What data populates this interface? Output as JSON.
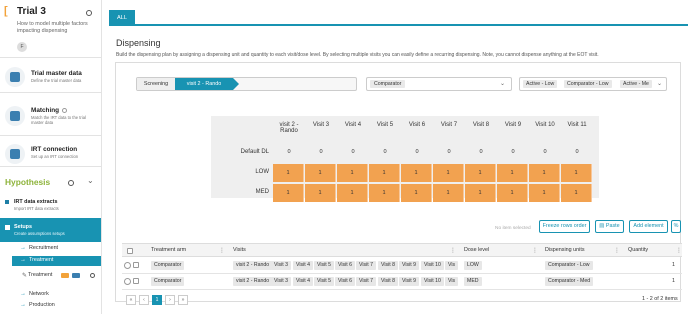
{
  "sidebar": {
    "trial_title": "Trial 3",
    "trial_desc": "How to model multiple factors impacting dispensing",
    "avatar_initial": "F",
    "cards": [
      {
        "title": "Trial master data",
        "subtitle": "Define the trial master data"
      },
      {
        "title": "Matching",
        "subtitle": "Match the IRT data to the trial master data"
      },
      {
        "title": "IRT connection",
        "subtitle": "Set up an IRT connection"
      }
    ],
    "hypothesis_title": "Hypothesis",
    "irt_title": "IRT data extracts",
    "irt_sub": "Import IRT data extracts",
    "setups_title": "Setups",
    "setups_sub": "Create assumptions setups",
    "tree": {
      "recruitment": "Recruitment",
      "treatment": "Treatment",
      "treatment_sub": "Treatment",
      "network": "Network",
      "production": "Production"
    }
  },
  "main": {
    "tab_all": "ALL",
    "title": "Dispensing",
    "description": "Build the dispensing plan by assigning a dispensing unit and quantity to each visit/dose level. By selecting multiple visits you can easily define a recurring dispensing. Note, you cannot dispense anything at the EOT visit.",
    "visit_bar": {
      "screening": "Screening",
      "current": "visit 2 - Rando"
    },
    "comparator_select": "Comparator",
    "tags": [
      "Active - Low",
      "Comparator - Low",
      "Active - Me"
    ],
    "grid": {
      "columns": [
        "visit 2 - Rando",
        "Visit 3",
        "Visit 4",
        "Visit 5",
        "Visit 6",
        "Visit 7",
        "Visit 8",
        "Visit 9",
        "Visit 10",
        "Visit 11"
      ],
      "rows": [
        {
          "label": "Default DL",
          "values": [
            "0",
            "0",
            "0",
            "0",
            "0",
            "0",
            "0",
            "0",
            "0",
            "0"
          ],
          "kind": "zero"
        },
        {
          "label": "LOW",
          "values": [
            "1",
            "1",
            "1",
            "1",
            "1",
            "1",
            "1",
            "1",
            "1",
            "1"
          ],
          "kind": "cell"
        },
        {
          "label": "MED",
          "values": [
            "1",
            "1",
            "1",
            "1",
            "1",
            "1",
            "1",
            "1",
            "1",
            "1"
          ],
          "kind": "cell"
        }
      ]
    },
    "toolbar": {
      "no_items": "No item selected",
      "freeze": "Freeze rows order",
      "paste": "Paste",
      "add": "Add element"
    },
    "table": {
      "headers": {
        "arm": "Treatment arm",
        "visits": "Visits",
        "dose": "Dose level",
        "units": "Dispensing units",
        "qty": "Quantity"
      },
      "rows": [
        {
          "arm": "Comparator",
          "visits": [
            "visit 2 - Rando",
            "Visit 3",
            "Visit 4",
            "Visit 5",
            "Visit 6",
            "Visit 7",
            "Visit 8",
            "Visit 9",
            "Visit 10",
            "Vis"
          ],
          "dose": "LOW",
          "units": "Comparator - Low",
          "qty": "1"
        },
        {
          "arm": "Comparator",
          "visits": [
            "visit 2 - Rando",
            "Visit 3",
            "Visit 4",
            "Visit 5",
            "Visit 6",
            "Visit 7",
            "Visit 8",
            "Visit 9",
            "Visit 10",
            "Vis"
          ],
          "dose": "MED",
          "units": "Comparator - Med",
          "qty": "1"
        }
      ]
    },
    "pager": {
      "current": "1",
      "info": "1 - 2 of 2 items"
    }
  },
  "colors": {
    "accent": "#1893b2",
    "cell": "#f2a250",
    "hypothesis": "#8db33a",
    "trial_mark": "#f2a23a"
  }
}
